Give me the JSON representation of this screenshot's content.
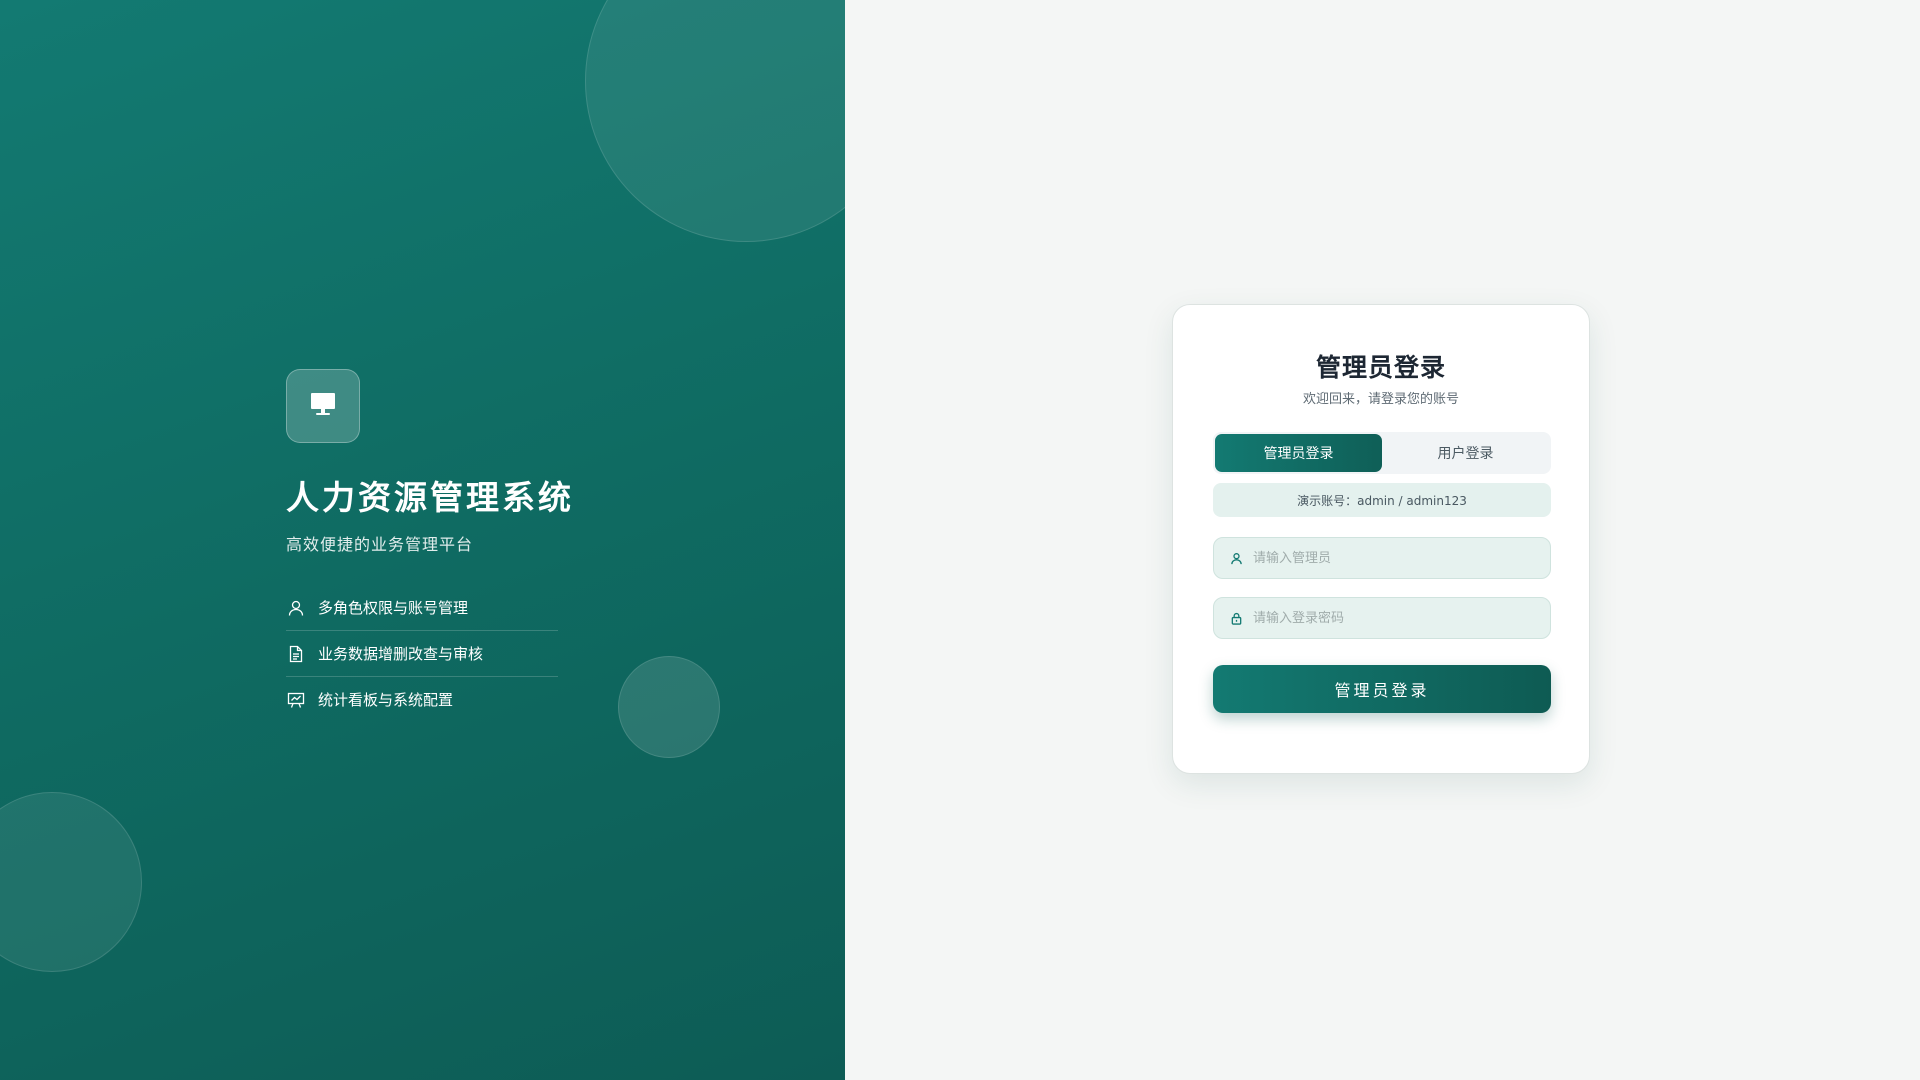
{
  "brand": {
    "icon": "monitor-icon",
    "title": "人力资源管理系统",
    "subtitle": "高效便捷的业务管理平台"
  },
  "features": [
    {
      "icon": "user-icon",
      "label": "多角色权限与账号管理"
    },
    {
      "icon": "document-icon",
      "label": "业务数据增删改查与审核"
    },
    {
      "icon": "presentation-chart-icon",
      "label": "统计看板与系统配置"
    }
  ],
  "login": {
    "title": "管理员登录",
    "subtitle": "欢迎回来，请登录您的账号",
    "tabs": [
      {
        "label": "管理员登录",
        "active": true
      },
      {
        "label": "用户登录",
        "active": false
      }
    ],
    "demo_hint": "演示账号：admin / admin123",
    "username_placeholder": "请输入管理员",
    "username_value": "",
    "password_placeholder": "请输入登录密码",
    "password_value": "",
    "submit_label": "管理员登录"
  },
  "colors": {
    "primary": "#137a72",
    "primary_dark": "#0e5b53",
    "input_bg": "#e6f2ef",
    "page_bg": "#f4f6f5"
  }
}
